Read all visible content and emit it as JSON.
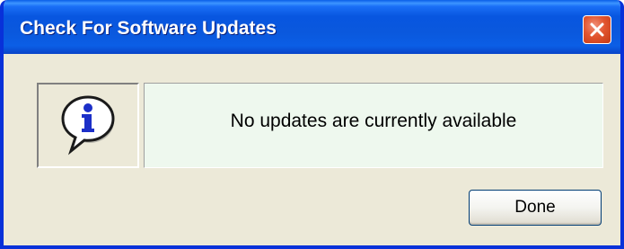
{
  "window": {
    "title": "Check For Software Updates"
  },
  "message": {
    "text": "No updates are currently available"
  },
  "buttons": {
    "done_label": "Done"
  },
  "icons": {
    "info": "info-speech-bubble-icon",
    "close": "close-icon"
  },
  "colors": {
    "titlebar": "#0856e0",
    "window_bg": "#ece9d8",
    "message_bg": "#eef8ee",
    "close_button": "#e2552f"
  }
}
